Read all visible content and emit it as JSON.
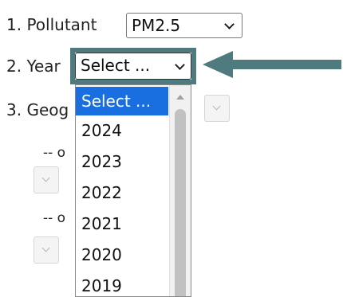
{
  "form": {
    "pollutant_label": "1. Pollutant",
    "pollutant_value": "PM2.5",
    "year_label": "2. Year",
    "year_value": "Select ...",
    "geography_label": "3. Geog",
    "or_text": "-- o"
  },
  "year_dropdown": {
    "options": [
      "Select ...",
      "2024",
      "2023",
      "2022",
      "2021",
      "2020",
      "2019"
    ],
    "selected_index": 0
  },
  "colors": {
    "highlight": "#4f7a7e",
    "selected_option_bg": "#1a6fe0"
  }
}
